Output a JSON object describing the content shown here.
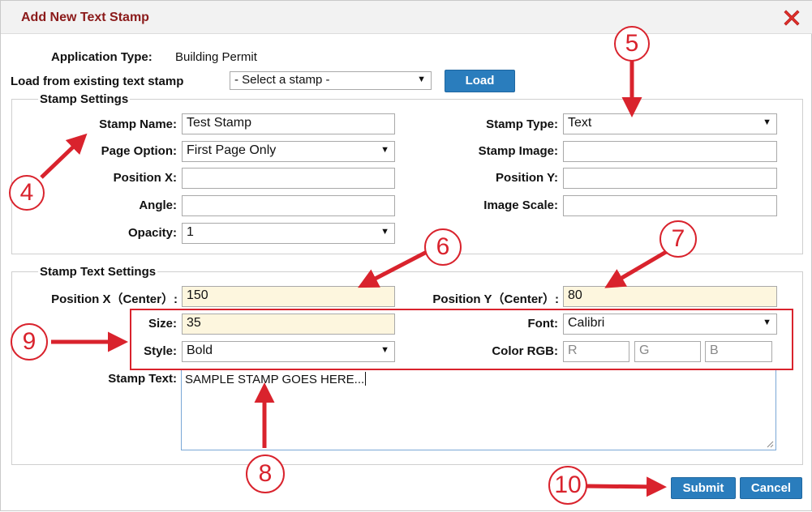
{
  "dialog": {
    "title": "Add New Text Stamp"
  },
  "application": {
    "label": "Application Type:",
    "value": "Building Permit"
  },
  "load_existing": {
    "label": "Load from existing text stamp",
    "select_value": "- Select a stamp -",
    "button": "Load"
  },
  "stamp_settings": {
    "legend": "Stamp Settings",
    "stamp_name_label": "Stamp Name:",
    "stamp_name_value": "Test Stamp",
    "page_option_label": "Page Option:",
    "page_option_value": "First Page Only",
    "position_x_label": "Position X:",
    "position_x_value": "",
    "angle_label": "Angle:",
    "angle_value": "",
    "opacity_label": "Opacity:",
    "opacity_value": "1",
    "stamp_type_label": "Stamp Type:",
    "stamp_type_value": "Text",
    "stamp_image_label": "Stamp Image:",
    "stamp_image_value": "",
    "position_y_label": "Position Y:",
    "position_y_value": "",
    "image_scale_label": "Image Scale:",
    "image_scale_value": ""
  },
  "text_settings": {
    "legend": "Stamp Text Settings",
    "position_x_center_label": "Position X（Center）:",
    "position_x_center_value": "150",
    "position_y_center_label": "Position Y（Center）:",
    "position_y_center_value": "80",
    "size_label": "Size:",
    "size_value": "35",
    "style_label": "Style:",
    "style_value": "Bold",
    "font_label": "Font:",
    "font_value": "Calibri",
    "color_rgb_label": "Color RGB:",
    "color_r_placeholder": "R",
    "color_g_placeholder": "G",
    "color_b_placeholder": "B",
    "stamp_text_label": "Stamp Text:",
    "stamp_text_value": "SAMPLE STAMP GOES HERE..."
  },
  "footer": {
    "submit": "Submit",
    "cancel": "Cancel"
  },
  "annotations": {
    "n4": "4",
    "n5": "5",
    "n6": "6",
    "n7": "7",
    "n8": "8",
    "n9": "9",
    "n10": "10"
  },
  "colors": {
    "title": "#8b1a1a",
    "button": "#2a7dbd",
    "highlight_field": "#fdf6de",
    "annotation_red": "#d9232d",
    "close_icon": "#e0302a"
  },
  "icons": {
    "close": "close-icon",
    "dropdown": "chevron-down-icon",
    "resize": "resize-grip-icon"
  }
}
